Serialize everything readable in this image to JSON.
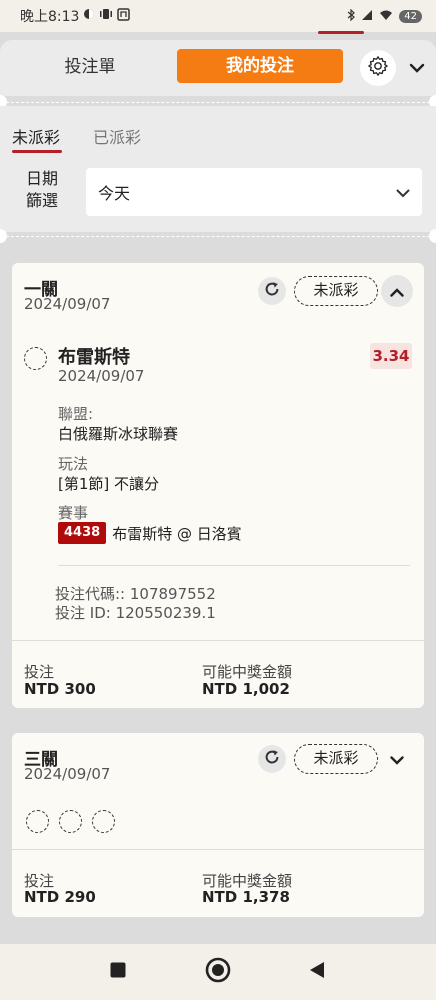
{
  "status_bar": {
    "time": "晚上8:13",
    "battery": "42"
  },
  "header": {
    "tab_slip_label": "投注單",
    "tab_my_bets_label": "我的投注"
  },
  "filter": {
    "tab_unsettled": "未派彩",
    "tab_settled": "已派彩",
    "date_label_line1": "日期",
    "date_label_line2": "篩選",
    "date_value": "今天"
  },
  "bets": [
    {
      "type": "一關",
      "date": "2024/09/07",
      "status": "未派彩",
      "selection": {
        "name": "布雷斯特",
        "date": "2024/09/07",
        "odds": "3.34",
        "league_label": "聯盟:",
        "league": "白俄羅斯冰球聯賽",
        "market_label": "玩法",
        "market": "[第1節] 不讓分",
        "event_label": "賽事",
        "event_id": "4438",
        "event_name": "布雷斯特 @ 日洛賓"
      },
      "bet_code": "投注代碼:: 107897552",
      "bet_id": "投注 ID: 120550239.1",
      "stake_label": "投注",
      "stake": "NTD 300",
      "payout_label": "可能中獎金額",
      "payout": "NTD 1,002"
    },
    {
      "type": "三關",
      "date": "2024/09/07",
      "status": "未派彩",
      "stake_label": "投注",
      "stake": "NTD 290",
      "payout_label": "可能中獎金額",
      "payout": "NTD 1,378"
    }
  ],
  "colors": {
    "accent": "#f57c12",
    "brand_red": "#b3202a",
    "badge_red": "#b00b0b"
  },
  "icons": [
    "dnd-icon",
    "vibrate-icon",
    "nfc-icon",
    "bluetooth-icon",
    "signal-icon",
    "wifi-icon",
    "gear-icon",
    "chevron-down-icon",
    "refresh-icon",
    "chevron-up-icon",
    "square-nav-icon",
    "home-nav-icon",
    "back-nav-icon"
  ]
}
